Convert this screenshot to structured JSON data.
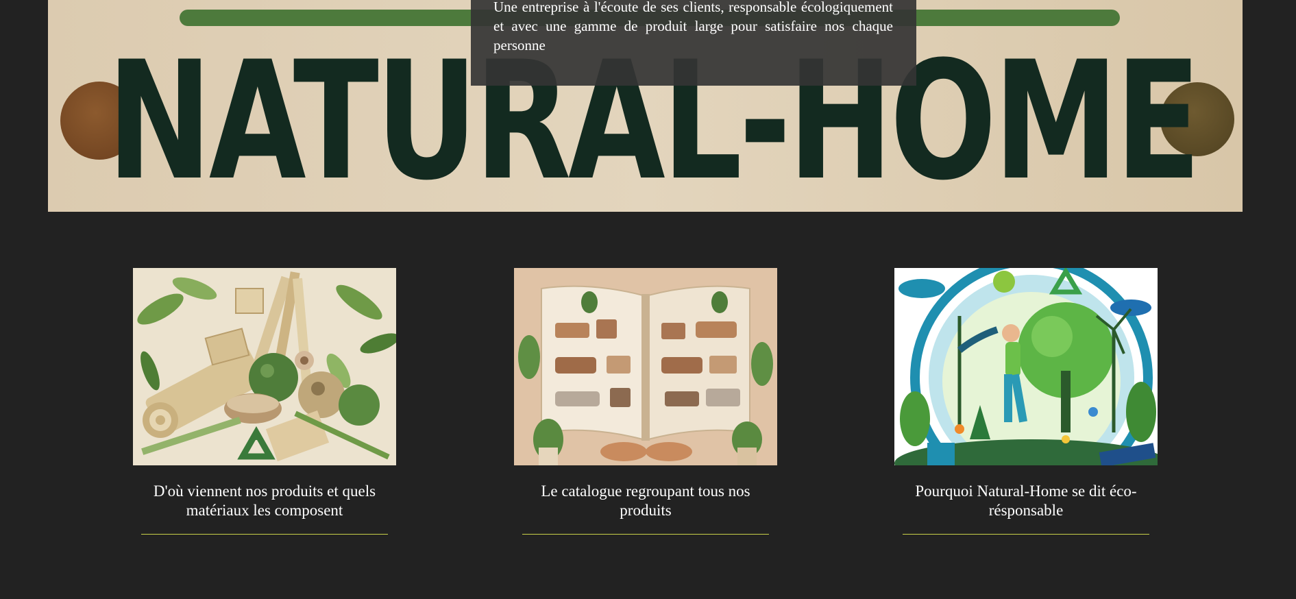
{
  "banner": {
    "wordmark": "NATURAL-HOME",
    "tagline": "Une entreprise à l'écoute de ses clients, responsable écologiquement et avec une gamme de produit large pour satisfaire nos chaque personne",
    "colors": {
      "background": "#e3d5bd",
      "wordmark": "#132a20",
      "bar": "#4d7a3c"
    }
  },
  "cards": [
    {
      "title": "D'où viennent nos produits et quels matériaux les composent",
      "image": "natural-materials-illustration"
    },
    {
      "title": "Le catalogue regroupant tous nos produits",
      "image": "furniture-catalogue-book-illustration"
    },
    {
      "title": "Pourquoi Natural-Home se dit éco-résponsable",
      "image": "eco-responsible-illustration"
    }
  ],
  "colors": {
    "page_background": "#222222",
    "text": "#ffffff",
    "card_underline": "#c9d14a"
  }
}
